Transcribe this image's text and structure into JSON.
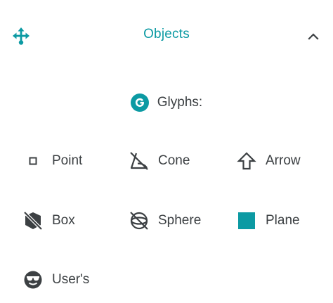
{
  "header": {
    "title": "Objects",
    "icon": "move-arrows-icon",
    "collapse_icon": "chevron-up-icon"
  },
  "glyphs_section": {
    "badge_letter": "G",
    "title": "Glyphs:",
    "items": [
      {
        "label": "Point",
        "icon": "point-square-icon"
      },
      {
        "label": "Cone",
        "icon": "cone-off-icon"
      },
      {
        "label": "Arrow",
        "icon": "arrow-up-outline-icon"
      },
      {
        "label": "Box",
        "icon": "box-off-icon"
      },
      {
        "label": "Sphere",
        "icon": "sphere-off-icon"
      },
      {
        "label": "Plane",
        "icon": "plane-square-icon"
      },
      {
        "label": "User's",
        "icon": "user-glasses-icon"
      }
    ]
  },
  "colors": {
    "accent": "#0c9aa3",
    "text": "#3c4043",
    "icon": "#3c4043"
  }
}
